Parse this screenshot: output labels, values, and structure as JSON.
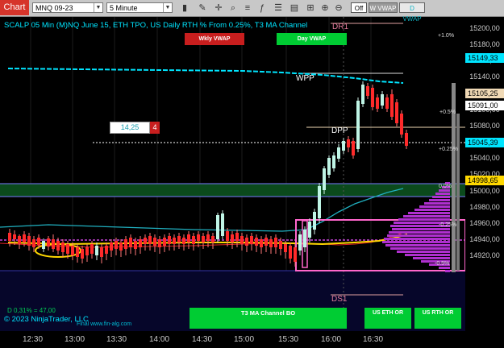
{
  "toolbar": {
    "chart_label": "Chart",
    "instrument": "MNQ 09-23",
    "interval": "5 Minute",
    "toggle_off": "Off",
    "toggle_wvwap": "W VWAP",
    "toggle_dvwap": "D VWAP"
  },
  "header": {
    "title": "SCALP 05 Min (M)NQ June 15, ETH TPO, US Daily RTH % From 0.25%, T3 MA Channel",
    "wkly_vwap_label": "Wkly VWAP",
    "day_vwap_label": "Day VWAP"
  },
  "levels": {
    "dr1": "DR1",
    "wpp": "WPP",
    "dpp": "DPP",
    "ds1": "DS1",
    "pct_plus_1": "+1.0%",
    "pct_plus_05": "+0.5%",
    "pct_plus_025": "+0.25%",
    "pct_zero": "0.0%",
    "pct_minus_025": "-0.25%",
    "pct_minus_05": "-0.5%"
  },
  "order": {
    "price": "14,25",
    "qty": "4"
  },
  "bottom": {
    "position_text": "D 0,31% = 47,00",
    "copyright": "© 2023 NinjaTrader, LLC",
    "watermark": "Final  www.fin-alg.com",
    "t3_label": "T3 MA Channel BO",
    "us_eth_label": "US ETH OR",
    "us_rth_label": "US RTH OR"
  },
  "price_axis": {
    "labels": [
      "15200,00",
      "15180,00",
      "15160,00",
      "15140,00",
      "15120,00",
      "15100,00",
      "15080,00",
      "15060,00",
      "15040,00",
      "15020,00",
      "15000,00",
      "14980,00",
      "14960,00",
      "14940,00",
      "14920,00"
    ],
    "tags": [
      {
        "text": "15149,33",
        "bg": "#00e5ff",
        "fg": "#000000",
        "price": 15149.33
      },
      {
        "text": "15105,25",
        "bg": "#f0d9b5",
        "fg": "#000000",
        "price": 15105.25
      },
      {
        "text": "15091,00",
        "bg": "#ffffff",
        "fg": "#000000",
        "price": 15091.0
      },
      {
        "text": "15045,39",
        "bg": "#00e5ff",
        "fg": "#000000",
        "price": 15045.39
      },
      {
        "text": "14998,65",
        "bg": "#ffd800",
        "fg": "#000000",
        "price": 14998.65
      }
    ]
  },
  "time_axis": {
    "labels": [
      "12:30",
      "13:00",
      "13:30",
      "14:00",
      "14:30",
      "15:00",
      "15:30",
      "16:00",
      "16:30"
    ]
  },
  "colors": {
    "up": "#7fffd4",
    "down": "#ff2a2a",
    "vwap_day": "#ffd800",
    "vwap_week": "#00e5ff",
    "channel": "#1a9aaa",
    "profile": "#b030d0",
    "green_button": "#00cc33"
  }
}
